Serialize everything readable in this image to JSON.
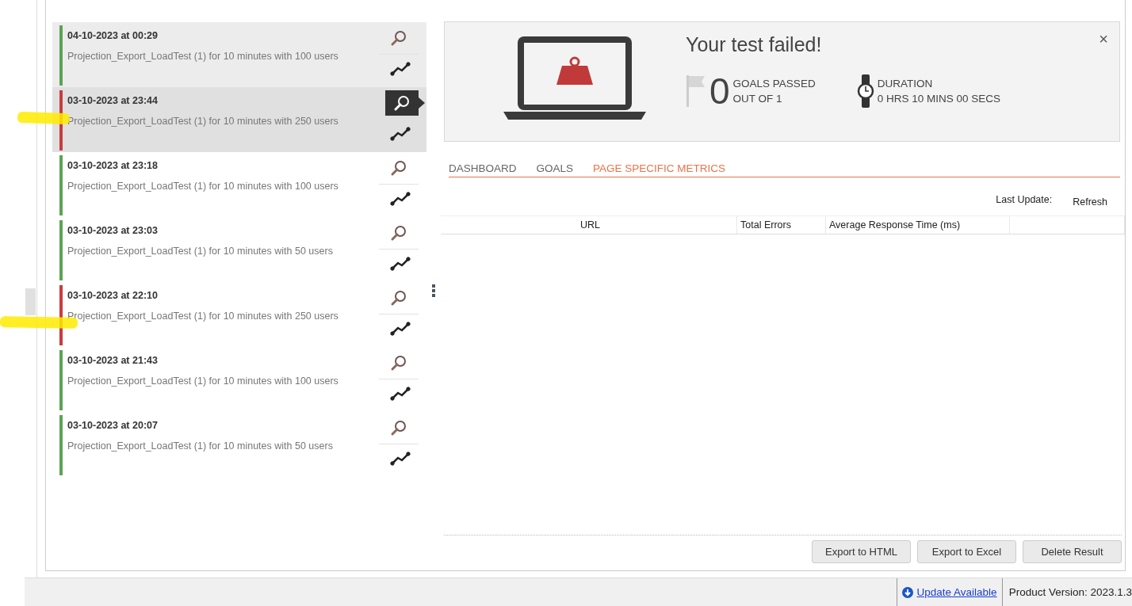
{
  "results": [
    {
      "date": "04-10-2023 at 00:29",
      "description": "Projection_Export_LoadTest (1) for 10 minutes with 100 users",
      "color": "#5aa552",
      "selected": false,
      "hovered": true
    },
    {
      "date": "03-10-2023 at 23:44",
      "description": "Projection_Export_LoadTest (1) for 10 minutes with 250 users",
      "color": "#c93c3c",
      "selected": true,
      "hovered": false
    },
    {
      "date": "03-10-2023 at 23:18",
      "description": "Projection_Export_LoadTest (1) for 10 minutes with 100 users",
      "color": "#5aa552",
      "selected": false,
      "hovered": false
    },
    {
      "date": "03-10-2023 at 23:03",
      "description": "Projection_Export_LoadTest (1) for 10 minutes with 50 users",
      "color": "#5aa552",
      "selected": false,
      "hovered": false
    },
    {
      "date": "03-10-2023 at 22:10",
      "description": "Projection_Export_LoadTest (1) for 10 minutes with 250 users",
      "color": "#c93c3c",
      "selected": false,
      "hovered": false
    },
    {
      "date": "03-10-2023 at 21:43",
      "description": "Projection_Export_LoadTest (1) for 10 minutes with 100 users",
      "color": "#5aa552",
      "selected": false,
      "hovered": false
    },
    {
      "date": "03-10-2023 at 20:07",
      "description": "Projection_Export_LoadTest (1) for 10 minutes with 50 users",
      "color": "#5aa552",
      "selected": false,
      "hovered": false
    }
  ],
  "summary": {
    "title": "Your test failed!",
    "close": "×",
    "goals_count": "0",
    "goals_label": "GOALS PASSED",
    "goals_sub": "OUT OF 1",
    "duration_label": "DURATION",
    "duration_value": "0 HRS  10 MINS  00 SECS"
  },
  "tabs": [
    {
      "label": "DASHBOARD",
      "selected": false
    },
    {
      "label": "GOALS",
      "selected": false
    },
    {
      "label": "PAGE SPECIFIC METRICS",
      "selected": true
    }
  ],
  "last_update_label": "Last Update:",
  "refresh": "Refresh",
  "table": {
    "columns": [
      "URL",
      "Total Errors",
      "Average Response Time (ms)"
    ]
  },
  "buttons": [
    "Export to HTML",
    "Export to Excel",
    "Delete Result"
  ],
  "status_bar": {
    "update_link": "Update Available",
    "version": "Product Version: 2023.1.3"
  }
}
